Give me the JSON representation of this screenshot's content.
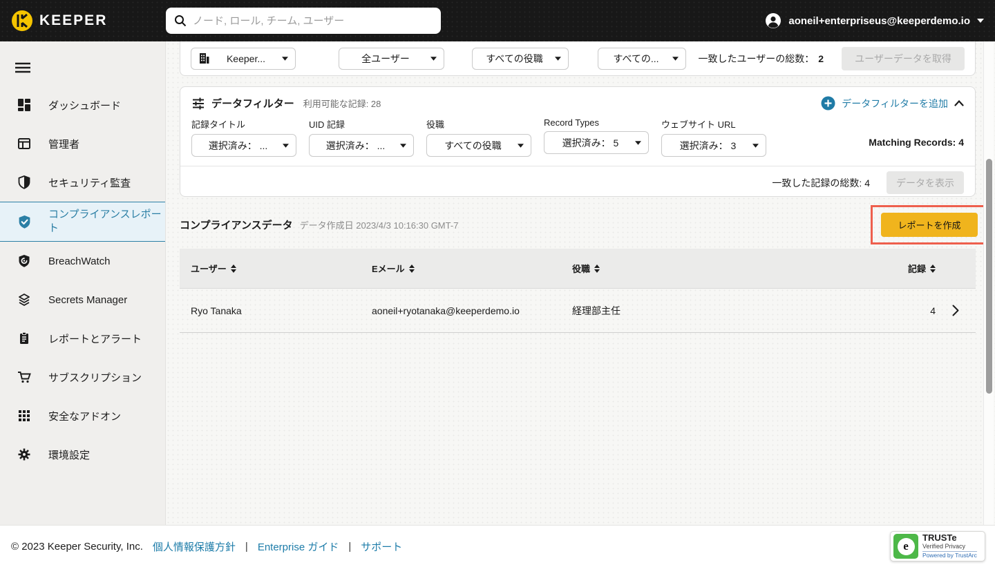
{
  "topbar": {
    "brand": "KEEPER",
    "search_placeholder": "ノード, ロール, チーム, ユーザー",
    "account_email": "aoneil+enterpriseus@keeperdemo.io"
  },
  "sidebar": {
    "items": [
      {
        "label": "ダッシュボード"
      },
      {
        "label": "管理者"
      },
      {
        "label": "セキュリティ監査"
      },
      {
        "label": "コンプライアンスレポート"
      },
      {
        "label": "BreachWatch"
      },
      {
        "label": "Secrets Manager"
      },
      {
        "label": "レポートとアラート"
      },
      {
        "label": "サブスクリプション"
      },
      {
        "label": "安全なアドオン"
      },
      {
        "label": "環境設定"
      }
    ]
  },
  "user_filter_bar": {
    "node_dropdown": "Keeper...",
    "users_dropdown": "全ユーザー",
    "roles_dropdown": "すべての役職",
    "teams_dropdown": "すべての...",
    "matched_users_label": "一致したユーザーの総数：",
    "matched_users_count": "2",
    "get_user_data_button": "ユーザーデータを取得"
  },
  "data_filter": {
    "title": "データフィルター",
    "available_records": "利用可能な記録: 28",
    "add_filter_link": "データフィルターを追加",
    "filters": [
      {
        "label": "記録タイトル",
        "value": "選択済み： ..."
      },
      {
        "label": "UID 記録",
        "value": "選択済み： ..."
      },
      {
        "label": "役職",
        "value": "すべての役職"
      },
      {
        "label": "Record Types",
        "value": "選択済み： 5"
      },
      {
        "label": "ウェブサイト URL",
        "value": "選択済み： 3"
      }
    ],
    "matching_records": "Matching Records: 4",
    "matched_total": "一致した記録の総数: 4",
    "show_data_button": "データを表示"
  },
  "compliance": {
    "title": "コンプライアンスデータ",
    "created": "データ作成日 2023/4/3 10:16:30 GMT-7",
    "create_report_button": "レポートを作成"
  },
  "table": {
    "headers": [
      "ユーザー",
      "Eメール",
      "役職",
      "記録"
    ],
    "rows": [
      {
        "user": "Ryo Tanaka",
        "email": "aoneil+ryotanaka@keeperdemo.io",
        "role": "経理部主任",
        "records": "4"
      }
    ]
  },
  "footer": {
    "copyright": "© 2023 Keeper Security, Inc.",
    "links": [
      "個人情報保護方針",
      "Enterprise ガイド",
      "サポート"
    ],
    "separator": "|",
    "truste": {
      "title": "TRUSTe",
      "line2": "Verified Privacy",
      "line3": "Powered by TrustArc",
      "logo_letter": "e"
    }
  },
  "colors": {
    "accent_blue": "#2b7fa5",
    "link_blue": "#1d7ca9",
    "brand_gold": "#f0b41d",
    "annotation_red": "#ee5f4d",
    "truste_green": "#4db848",
    "topbar_bg": "#181818",
    "sidebar_bg": "#f0efed"
  }
}
